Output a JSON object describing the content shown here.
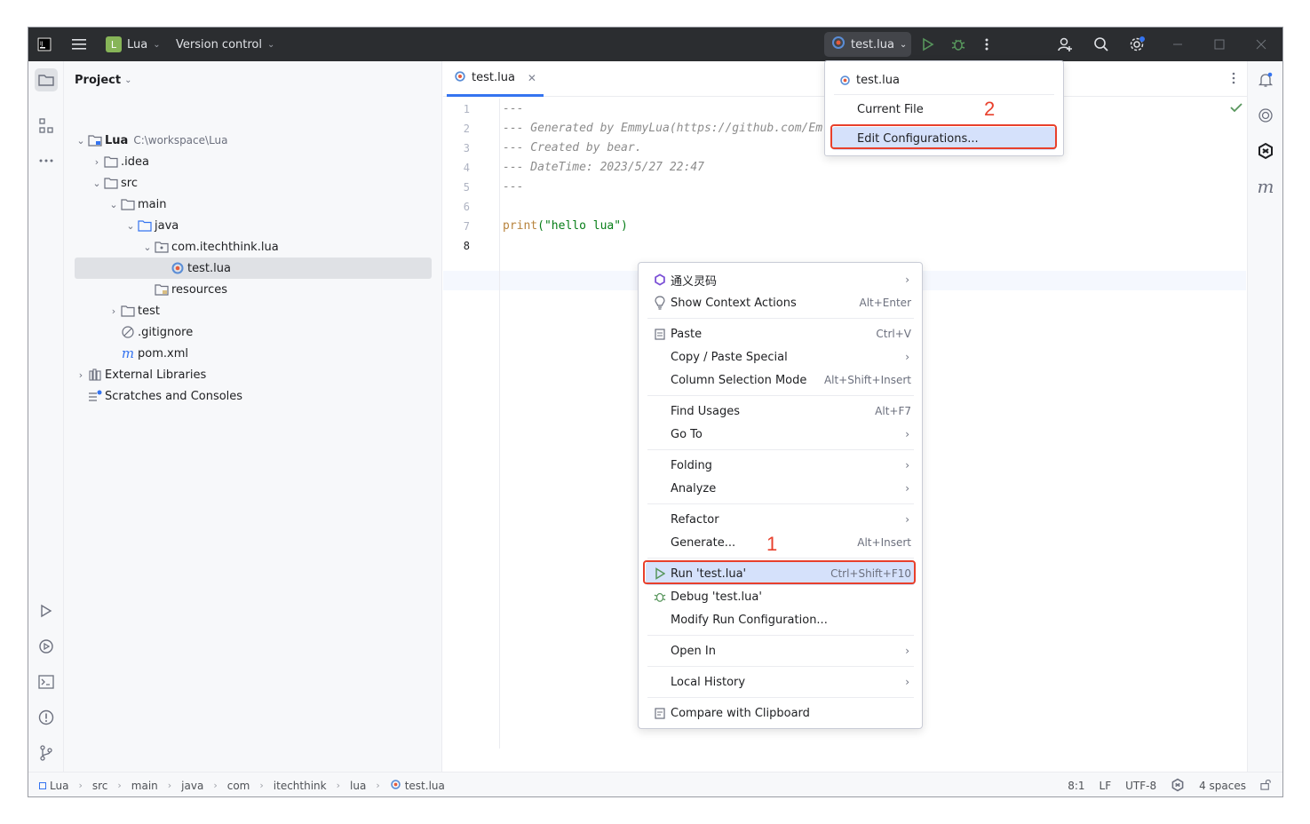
{
  "titlebar": {
    "app_icon": "intellij-logo-icon",
    "menu_icon": "hamburger-menu-icon",
    "project_badge": "L",
    "project_name": "Lua",
    "vcs_label": "Version control",
    "run_config": "test.lua",
    "accent": "#2b2d30"
  },
  "project_panel": {
    "title": "Project",
    "tree": [
      {
        "label": "Lua",
        "path_hint": "C:\\workspace\\Lua",
        "icon": "module-folder-icon"
      },
      {
        "label": ".idea",
        "icon": "folder-icon"
      },
      {
        "label": "src",
        "icon": "folder-icon"
      },
      {
        "label": "main",
        "icon": "folder-icon"
      },
      {
        "label": "java",
        "icon": "source-folder-icon"
      },
      {
        "label": "com.itechthink.lua",
        "icon": "package-icon"
      },
      {
        "label": "test.lua",
        "icon": "lua-file-icon"
      },
      {
        "label": "resources",
        "icon": "resources-folder-icon"
      },
      {
        "label": "test",
        "icon": "folder-icon"
      },
      {
        "label": ".gitignore",
        "icon": "ignore-file-icon"
      },
      {
        "label": "pom.xml",
        "icon": "maven-icon"
      },
      {
        "label": "External Libraries",
        "icon": "library-icon"
      },
      {
        "label": "Scratches and Consoles",
        "icon": "scratches-icon"
      }
    ]
  },
  "editor": {
    "tab_label": "test.lua",
    "line_numbers": [
      "1",
      "2",
      "3",
      "4",
      "5",
      "6",
      "7",
      "8"
    ],
    "lines": [
      "---",
      "--- Generated by EmmyLua(https://github.com/Em",
      "--- Created by bear.",
      "--- DateTime: 2023/5/27 22:47",
      "---",
      "",
      "print",
      ""
    ],
    "print_args": "(\"hello lua\")"
  },
  "context_menu": {
    "items": [
      {
        "label": "通义灵码",
        "shortcut": "",
        "submenu": true,
        "icon": "tongyi-icon"
      },
      {
        "label": "Show Context Actions",
        "shortcut": "Alt+Enter",
        "submenu": false,
        "icon": "lightbulb-icon"
      },
      {
        "label": "Paste",
        "shortcut": "Ctrl+V",
        "submenu": false,
        "icon": "clipboard-icon"
      },
      {
        "label": "Copy / Paste Special",
        "shortcut": "",
        "submenu": true,
        "icon": ""
      },
      {
        "label": "Column Selection Mode",
        "shortcut": "Alt+Shift+Insert",
        "submenu": false,
        "icon": ""
      },
      {
        "label": "Find Usages",
        "shortcut": "Alt+F7",
        "submenu": false,
        "icon": ""
      },
      {
        "label": "Go To",
        "shortcut": "",
        "submenu": true,
        "icon": ""
      },
      {
        "label": "Folding",
        "shortcut": "",
        "submenu": true,
        "icon": ""
      },
      {
        "label": "Analyze",
        "shortcut": "",
        "submenu": true,
        "icon": ""
      },
      {
        "label": "Refactor",
        "shortcut": "",
        "submenu": true,
        "icon": ""
      },
      {
        "label": "Generate...",
        "shortcut": "Alt+Insert",
        "submenu": false,
        "icon": ""
      },
      {
        "label": "Run 'test.lua'",
        "shortcut": "Ctrl+Shift+F10",
        "submenu": false,
        "icon": "run-icon"
      },
      {
        "label": "Debug 'test.lua'",
        "shortcut": "",
        "submenu": false,
        "icon": "debug-icon"
      },
      {
        "label": "Modify Run Configuration...",
        "shortcut": "",
        "submenu": false,
        "icon": ""
      },
      {
        "label": "Open In",
        "shortcut": "",
        "submenu": true,
        "icon": ""
      },
      {
        "label": "Local History",
        "shortcut": "",
        "submenu": true,
        "icon": ""
      },
      {
        "label": "Compare with Clipboard",
        "shortcut": "",
        "submenu": false,
        "icon": "compare-icon"
      }
    ]
  },
  "run_popup": {
    "items": [
      "test.lua",
      "Current File",
      "Edit Configurations..."
    ]
  },
  "annotations": {
    "step1": "1",
    "step2": "2",
    "color": "#e8402c"
  },
  "breadcrumbs": [
    "Lua",
    "src",
    "main",
    "java",
    "com",
    "itechthink",
    "lua",
    "test.lua"
  ],
  "status": {
    "position": "8:1",
    "line_sep": "LF",
    "encoding": "UTF-8",
    "indent": "4 spaces"
  }
}
